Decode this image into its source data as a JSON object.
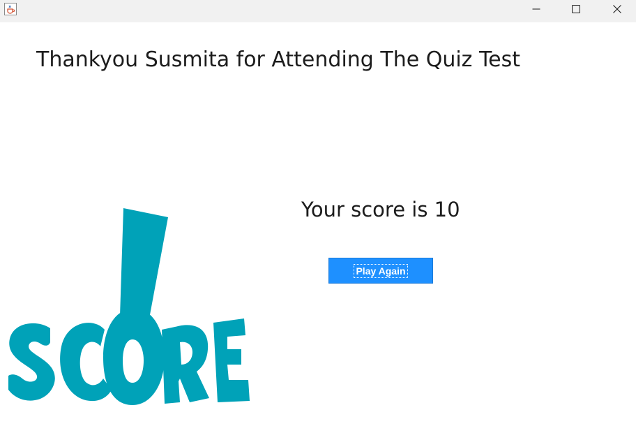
{
  "window": {
    "icon": "java-cup-icon",
    "controls": [
      "minimize-icon",
      "maximize-icon",
      "close-icon"
    ]
  },
  "main": {
    "heading": "Thankyou Susmita for Attending The Quiz Test",
    "score_text": "Your score is 10",
    "play_again_label": "Play Again",
    "graphic_label": "SCORE"
  },
  "colors": {
    "accent": "#1e90ff",
    "graphic": "#00a2b8"
  }
}
